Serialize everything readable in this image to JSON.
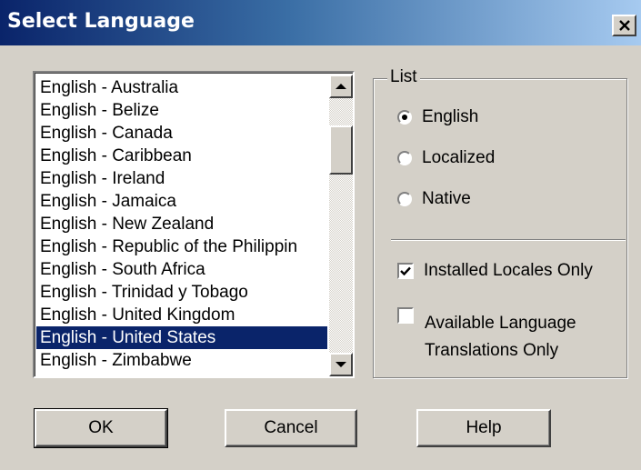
{
  "window": {
    "title": "Select Language",
    "close_glyph": "×"
  },
  "language_list": {
    "items": [
      "English - Australia",
      "English - Belize",
      "English - Canada",
      "English - Caribbean",
      "English - Ireland",
      "English - Jamaica",
      "English - New Zealand",
      "English - Republic of the Philippin",
      "English - South Africa",
      "English - Trinidad y Tobago",
      "English - United Kingdom",
      "English - United States",
      "English - Zimbabwe"
    ],
    "selected": "English - United States"
  },
  "list_group": {
    "label": "List",
    "radio_english": "English",
    "radio_localized": "Localized",
    "radio_native": "Native",
    "radio_selected": "English",
    "check_installed": "Installed Locales Only",
    "check_installed_checked": true,
    "check_available_line1": "Available Language",
    "check_available_line2": "Translations Only",
    "check_available_checked": false
  },
  "buttons": {
    "ok": "OK",
    "cancel": "Cancel",
    "help": "Help"
  },
  "colors": {
    "selection": "#0a246a",
    "face": "#d4d0c8"
  },
  "icons": {
    "close": "close-icon",
    "scroll_up": "arrow-up-icon",
    "scroll_down": "arrow-down-icon",
    "check": "checkmark-icon"
  }
}
